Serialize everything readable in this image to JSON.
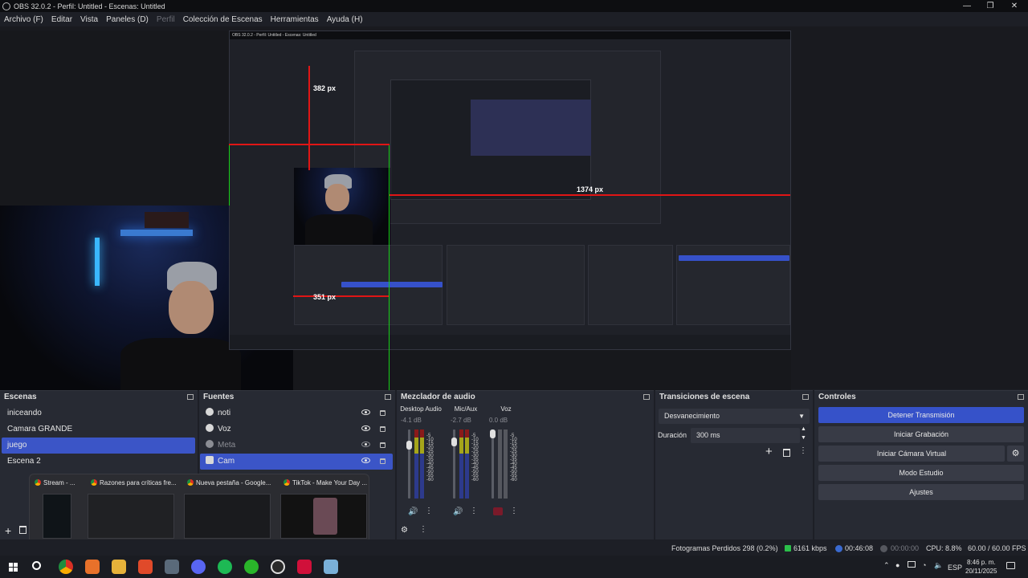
{
  "titlebar": {
    "title": "OBS 32.0.2 - Perfil: Untitled - Escenas: Untitled",
    "minimize": "—",
    "restore": "❐",
    "close": "✕"
  },
  "menu": [
    "Archivo (F)",
    "Editar",
    "Vista",
    "Paneles (D)",
    "Perfil",
    "Colección de Escenas",
    "Herramientas",
    "Ayuda (H)"
  ],
  "preview": {
    "measure_top": "382 px",
    "measure_right": "1374 px",
    "measure_left": "351 px",
    "nested_measure_top": "382 px",
    "nested_measure_right": "1374 px"
  },
  "scenes": {
    "title": "Escenas",
    "items": [
      "iniceando",
      "Camara GRANDE",
      "juego",
      "Escena 2"
    ],
    "selected": "juego"
  },
  "sources": {
    "title": "Fuentes",
    "items": [
      {
        "name": "noti",
        "icon": "speaker-icon",
        "visible": true,
        "dim": false
      },
      {
        "name": "Voz",
        "icon": "mic-icon",
        "visible": true,
        "dim": false
      },
      {
        "name": "Meta",
        "icon": "window-icon",
        "visible": false,
        "dim": true
      },
      {
        "name": "Cam",
        "icon": "camera-icon",
        "visible": true,
        "dim": false
      }
    ],
    "selected": "Cam"
  },
  "mixer": {
    "title": "Mezclador de audio",
    "channels": [
      {
        "name": "Desktop Audio",
        "db": "-4.1 dB",
        "muted": false
      },
      {
        "name": "Mic/Aux",
        "db": "-2.7 dB",
        "muted": false
      },
      {
        "name": "Voz",
        "db": "0.0 dB",
        "muted": true
      }
    ],
    "scale": [
      "-5",
      "-10",
      "-15",
      "-20",
      "-25",
      "-30",
      "-35",
      "-40",
      "-45",
      "-50",
      "-55",
      "-60"
    ]
  },
  "transitions": {
    "title": "Transiciones de escena",
    "selected": "Desvanecimiento",
    "duration_label": "Duración",
    "duration_value": "300 ms"
  },
  "controls": {
    "title": "Controles",
    "buttons": [
      "Detener Transmisión",
      "Iniciar Grabación",
      "Iniciar Cámara Virtual",
      "Modo Estudio",
      "Ajustes"
    ]
  },
  "status": {
    "dropped": "Fotogramas Perdidos 298 (0.2%)",
    "bitrate": "6161 kbps",
    "stream_time": "00:46:08",
    "rec_time": "00:00:00",
    "cpu": "CPU: 8.8%",
    "fps": "60.00 / 60.00 FPS"
  },
  "thumbnails": [
    {
      "title": "Stream - ..."
    },
    {
      "title": "Razones para críticas fre..."
    },
    {
      "title": "Nueva pestaña - Google..."
    },
    {
      "title": "TikTok - Make Your Day ..."
    }
  ],
  "taskbar": {
    "lang": "ESP",
    "time": "8:46 p. m.",
    "date": "20/11/2025"
  },
  "colors": {
    "accent": "#3b55c7",
    "measure_line": "#e01515",
    "bounding_box": "#18d018"
  }
}
